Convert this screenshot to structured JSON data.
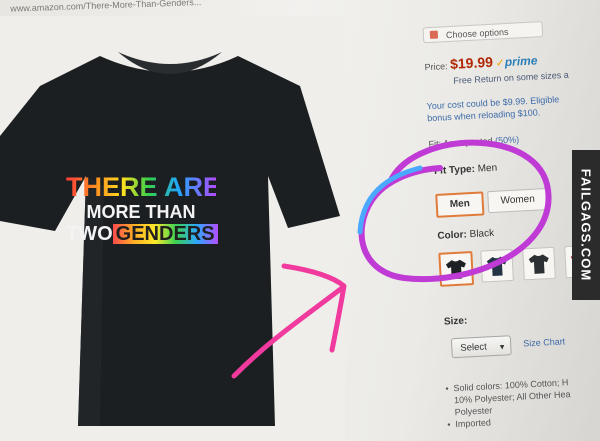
{
  "browser": {
    "url": "www.amazon.com/There-More-Than-Genders..."
  },
  "product": {
    "shirt_print": {
      "line1": "THERE ARE",
      "line2": "MORE THAN",
      "line3_prefix": "TWO",
      "line3_box": "GENDERS"
    }
  },
  "buy_box": {
    "choose_options": "Choose options",
    "price_label": "Price:",
    "price": "$19.99",
    "prime": "prime",
    "free_return": "Free Return on some sizes a",
    "cost_line": "Your cost could be $9.99. Eligible",
    "bonus_line": "bonus when reloading $100.",
    "fit_expect_prefix": "Fit: As expected",
    "fit_expect_link": "(50%)",
    "fit_type_label": "Fit Type:",
    "fit_type_value": "Men",
    "fit_options": [
      "Men",
      "Women"
    ],
    "color_label": "Color:",
    "color_value": "Black",
    "size_label": "Size:",
    "size_select": "Select",
    "size_chart": "Size Chart",
    "bullets": [
      "Solid colors: 100% Cotton; H",
      "10% Polyester; All Other Hea",
      "Polyester",
      "Imported"
    ]
  },
  "watermark": "FAILGAGS.COM",
  "colors": {
    "price": "#b12704",
    "selected_border": "#e07b39",
    "annotation_purple": "#c03ad6",
    "annotation_blue": "#4aa8ff",
    "annotation_pink": "#f03a9e"
  }
}
